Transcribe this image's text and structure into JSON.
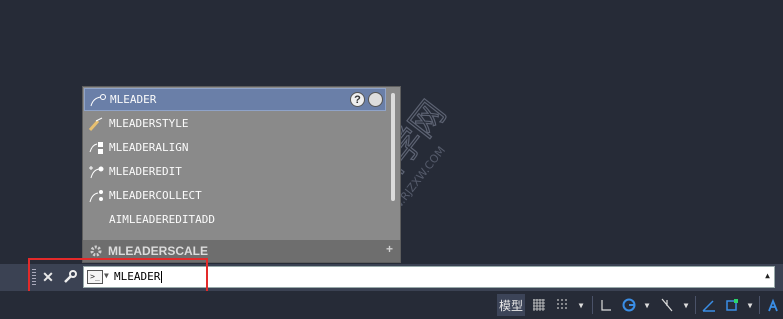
{
  "autocomplete": {
    "items": [
      {
        "label": "MLEADER",
        "icon": "multileader-icon",
        "selected": true
      },
      {
        "label": "MLEADERSTYLE",
        "icon": "multileader-style-icon"
      },
      {
        "label": "MLEADERALIGN",
        "icon": "multileader-align-icon"
      },
      {
        "label": "MLEADEREDIT",
        "icon": "multileader-edit-icon"
      },
      {
        "label": "MLEADERCOLLECT",
        "icon": "multileader-collect-icon"
      },
      {
        "label": "AIMLEADEREDITADD",
        "icon": ""
      }
    ],
    "help_label": "?",
    "bottom_item": "MLEADERSCALE",
    "bottom_plus": "+"
  },
  "command_line": {
    "close_label": "✕",
    "value": "MLEADER",
    "expand_label": "▲"
  },
  "status_bar": {
    "model_label": "模型"
  },
  "watermark": {
    "text": "软件自学网",
    "url": "WWW.RJZXW.COM"
  },
  "colors": {
    "canvas": "#262b37",
    "popup": "#8a8a8a",
    "selected": "#6a7fa8",
    "highlight": "#e32a2a",
    "accent_blue": "#3a8ee6"
  }
}
